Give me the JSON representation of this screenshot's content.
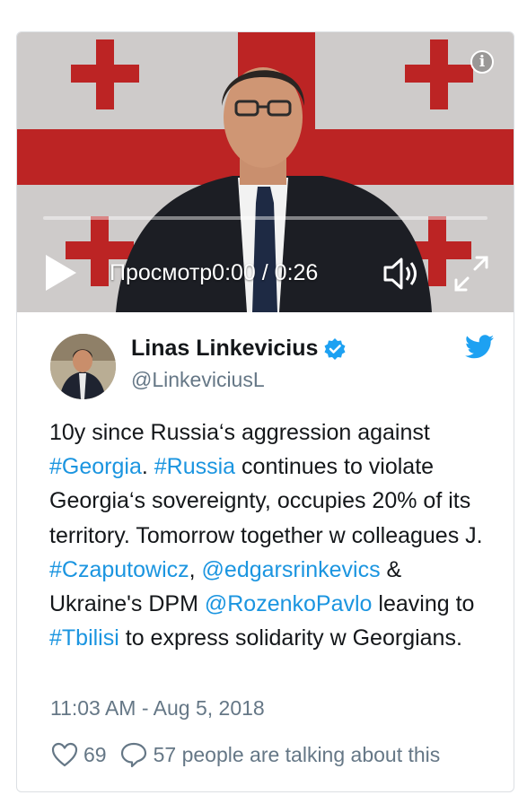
{
  "video": {
    "timestamp": "Просмотр0:00 / 0:26",
    "progress_fraction": 0.0
  },
  "tweet": {
    "author_name": "Linas Linkevicius",
    "author_handle": "@LinkeviciusL",
    "text_segments": [
      {
        "text": "10y since Russia‘s aggression against ",
        "link": false
      },
      {
        "text": "#Georgia",
        "link": true
      },
      {
        "text": ". ",
        "link": false
      },
      {
        "text": "#Russia",
        "link": true
      },
      {
        "text": " continues to violate Georgia‘s sovereignty, occupies 20% of its territory. Tomorrow together w colleagues J. ",
        "link": false
      },
      {
        "text": "#Czaputowicz",
        "link": true
      },
      {
        "text": ", ",
        "link": false
      },
      {
        "text": "@edgarsrinkevics",
        "link": true
      },
      {
        "text": " & Ukraine's DPM ",
        "link": false
      },
      {
        "text": "@RozenkoPavlo",
        "link": true
      },
      {
        "text": " leaving to ",
        "link": false
      },
      {
        "text": "#Tbilisi",
        "link": true
      },
      {
        "text": " to express solidarity w Georgians.",
        "link": false
      }
    ],
    "timestamp": "11:03 AM - Aug 5, 2018",
    "like_count": "69",
    "talking_text": "57 people are talking about this"
  },
  "colors": {
    "link": "#1b95e0",
    "verified": "#1da1f2",
    "secondary_text": "#657786",
    "flag_red": "#d62a2a"
  },
  "icons": [
    "info-icon",
    "play-icon",
    "volume-icon",
    "fullscreen-icon",
    "verified-icon",
    "twitter-bird-icon",
    "heart-icon",
    "speech-bubble-icon"
  ]
}
